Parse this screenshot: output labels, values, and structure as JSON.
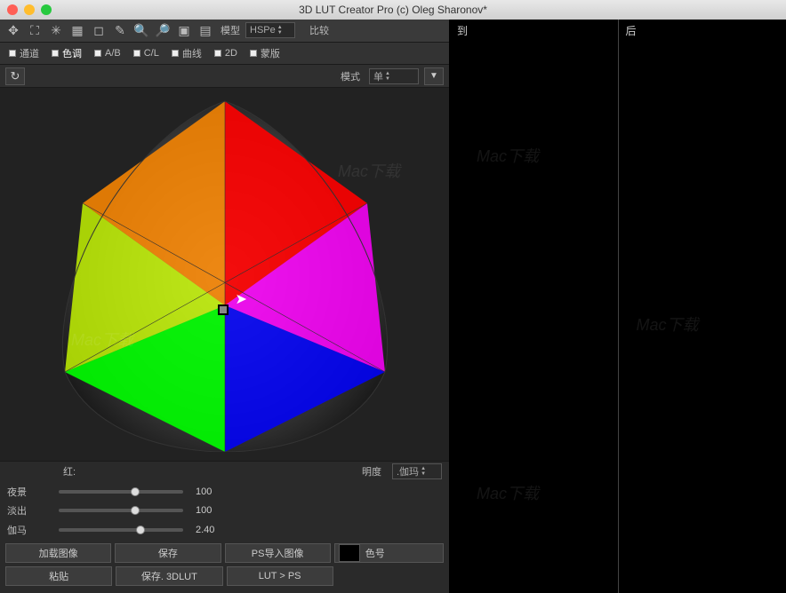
{
  "title": "3D LUT Creator Pro (c) Oleg Sharonov*",
  "preview": {
    "before_label": "到",
    "after_label": "后"
  },
  "toolbar": {
    "model_label": "模型",
    "model_value": "HSPe",
    "compare_label": "比较"
  },
  "tabs": {
    "channel": "通道",
    "hue": "色调",
    "ab": "A/B",
    "cl": "C/L",
    "curves": "曲线",
    "twod": "2D",
    "mask": "蒙版"
  },
  "mode": {
    "label": "模式",
    "value": "单"
  },
  "red_label": "红:",
  "brightness_label": "明度",
  "brightness_dropdown": ".伽玛",
  "sliders": {
    "night": {
      "name": "夜景",
      "value": "100",
      "pos": 58
    },
    "fade": {
      "name": "淡出",
      "value": "100",
      "pos": 58
    },
    "gamma": {
      "name": "伽马",
      "value": "2.40",
      "pos": 62
    }
  },
  "buttons": {
    "load_image": "加载图像",
    "save": "保存",
    "ps_import": "PS导入图像",
    "color_code": "色号",
    "paste": "粘贴",
    "save_3dlut": "保存. 3DLUT",
    "lut_to_ps": "LUT > PS"
  },
  "watermark": "Mac下载"
}
